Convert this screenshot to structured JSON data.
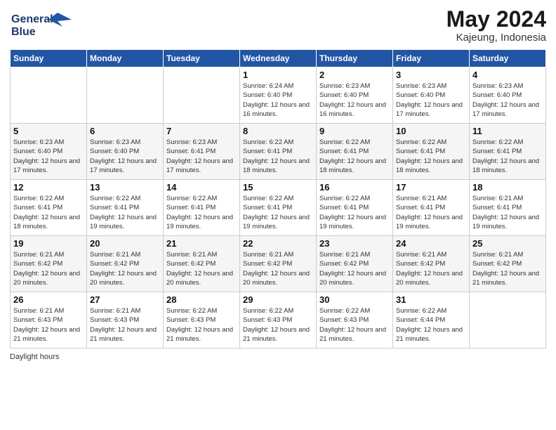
{
  "header": {
    "logo_line1": "General",
    "logo_line2": "Blue",
    "month_title": "May 2024",
    "location": "Kajeung, Indonesia"
  },
  "days_of_week": [
    "Sunday",
    "Monday",
    "Tuesday",
    "Wednesday",
    "Thursday",
    "Friday",
    "Saturday"
  ],
  "weeks": [
    [
      {
        "day": "",
        "info": ""
      },
      {
        "day": "",
        "info": ""
      },
      {
        "day": "",
        "info": ""
      },
      {
        "day": "1",
        "info": "Sunrise: 6:24 AM\nSunset: 6:40 PM\nDaylight: 12 hours\nand 16 minutes."
      },
      {
        "day": "2",
        "info": "Sunrise: 6:23 AM\nSunset: 6:40 PM\nDaylight: 12 hours\nand 16 minutes."
      },
      {
        "day": "3",
        "info": "Sunrise: 6:23 AM\nSunset: 6:40 PM\nDaylight: 12 hours\nand 17 minutes."
      },
      {
        "day": "4",
        "info": "Sunrise: 6:23 AM\nSunset: 6:40 PM\nDaylight: 12 hours\nand 17 minutes."
      }
    ],
    [
      {
        "day": "5",
        "info": "Sunrise: 6:23 AM\nSunset: 6:40 PM\nDaylight: 12 hours\nand 17 minutes."
      },
      {
        "day": "6",
        "info": "Sunrise: 6:23 AM\nSunset: 6:40 PM\nDaylight: 12 hours\nand 17 minutes."
      },
      {
        "day": "7",
        "info": "Sunrise: 6:23 AM\nSunset: 6:41 PM\nDaylight: 12 hours\nand 17 minutes."
      },
      {
        "day": "8",
        "info": "Sunrise: 6:22 AM\nSunset: 6:41 PM\nDaylight: 12 hours\nand 18 minutes."
      },
      {
        "day": "9",
        "info": "Sunrise: 6:22 AM\nSunset: 6:41 PM\nDaylight: 12 hours\nand 18 minutes."
      },
      {
        "day": "10",
        "info": "Sunrise: 6:22 AM\nSunset: 6:41 PM\nDaylight: 12 hours\nand 18 minutes."
      },
      {
        "day": "11",
        "info": "Sunrise: 6:22 AM\nSunset: 6:41 PM\nDaylight: 12 hours\nand 18 minutes."
      }
    ],
    [
      {
        "day": "12",
        "info": "Sunrise: 6:22 AM\nSunset: 6:41 PM\nDaylight: 12 hours\nand 18 minutes."
      },
      {
        "day": "13",
        "info": "Sunrise: 6:22 AM\nSunset: 6:41 PM\nDaylight: 12 hours\nand 19 minutes."
      },
      {
        "day": "14",
        "info": "Sunrise: 6:22 AM\nSunset: 6:41 PM\nDaylight: 12 hours\nand 19 minutes."
      },
      {
        "day": "15",
        "info": "Sunrise: 6:22 AM\nSunset: 6:41 PM\nDaylight: 12 hours\nand 19 minutes."
      },
      {
        "day": "16",
        "info": "Sunrise: 6:22 AM\nSunset: 6:41 PM\nDaylight: 12 hours\nand 19 minutes."
      },
      {
        "day": "17",
        "info": "Sunrise: 6:21 AM\nSunset: 6:41 PM\nDaylight: 12 hours\nand 19 minutes."
      },
      {
        "day": "18",
        "info": "Sunrise: 6:21 AM\nSunset: 6:41 PM\nDaylight: 12 hours\nand 19 minutes."
      }
    ],
    [
      {
        "day": "19",
        "info": "Sunrise: 6:21 AM\nSunset: 6:42 PM\nDaylight: 12 hours\nand 20 minutes."
      },
      {
        "day": "20",
        "info": "Sunrise: 6:21 AM\nSunset: 6:42 PM\nDaylight: 12 hours\nand 20 minutes."
      },
      {
        "day": "21",
        "info": "Sunrise: 6:21 AM\nSunset: 6:42 PM\nDaylight: 12 hours\nand 20 minutes."
      },
      {
        "day": "22",
        "info": "Sunrise: 6:21 AM\nSunset: 6:42 PM\nDaylight: 12 hours\nand 20 minutes."
      },
      {
        "day": "23",
        "info": "Sunrise: 6:21 AM\nSunset: 6:42 PM\nDaylight: 12 hours\nand 20 minutes."
      },
      {
        "day": "24",
        "info": "Sunrise: 6:21 AM\nSunset: 6:42 PM\nDaylight: 12 hours\nand 20 minutes."
      },
      {
        "day": "25",
        "info": "Sunrise: 6:21 AM\nSunset: 6:42 PM\nDaylight: 12 hours\nand 21 minutes."
      }
    ],
    [
      {
        "day": "26",
        "info": "Sunrise: 6:21 AM\nSunset: 6:43 PM\nDaylight: 12 hours\nand 21 minutes."
      },
      {
        "day": "27",
        "info": "Sunrise: 6:21 AM\nSunset: 6:43 PM\nDaylight: 12 hours\nand 21 minutes."
      },
      {
        "day": "28",
        "info": "Sunrise: 6:22 AM\nSunset: 6:43 PM\nDaylight: 12 hours\nand 21 minutes."
      },
      {
        "day": "29",
        "info": "Sunrise: 6:22 AM\nSunset: 6:43 PM\nDaylight: 12 hours\nand 21 minutes."
      },
      {
        "day": "30",
        "info": "Sunrise: 6:22 AM\nSunset: 6:43 PM\nDaylight: 12 hours\nand 21 minutes."
      },
      {
        "day": "31",
        "info": "Sunrise: 6:22 AM\nSunset: 6:44 PM\nDaylight: 12 hours\nand 21 minutes."
      },
      {
        "day": "",
        "info": ""
      }
    ]
  ],
  "footer": {
    "daylight_label": "Daylight hours"
  }
}
